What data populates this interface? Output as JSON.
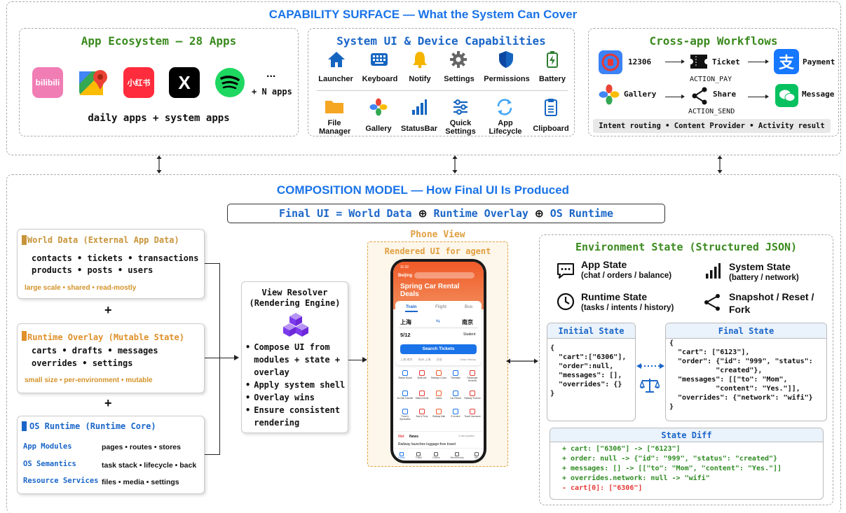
{
  "capability": {
    "title": "CAPABILITY SURFACE — What the System Can Cover",
    "app_ecosystem": {
      "title": "App Ecosystem — 28 Apps",
      "apps": [
        {
          "name": "bilibili",
          "label": "bilibili"
        },
        {
          "name": "maps",
          "label": ""
        },
        {
          "name": "xiaohongshu",
          "label": "小红书"
        },
        {
          "name": "x",
          "label": "X"
        },
        {
          "name": "spotify",
          "label": ""
        }
      ],
      "ellipsis": "...",
      "more": "+ N apps",
      "caption": "daily apps + system apps"
    },
    "system_ui": {
      "title": "System UI & Device Capabilities",
      "row1": [
        "Launcher",
        "Keyboard",
        "Notify",
        "Settings",
        "Permissions",
        "Battery"
      ],
      "row2": [
        "File Manager",
        "Gallery",
        "StatusBar",
        "Quick Settings",
        "App Lifecycle",
        "Clipboard"
      ]
    },
    "cross_app": {
      "title": "Cross-app Workflows",
      "flow1": {
        "from": "12306",
        "mid": "Ticket",
        "action": "ACTION_PAY",
        "to": "Payment"
      },
      "flow2": {
        "from": "Gallery",
        "mid": "Share",
        "action": "ACTION_SEND",
        "to": "Message"
      },
      "footer": "Intent routing • Content Provider • Activity result"
    }
  },
  "composition": {
    "title": "COMPOSITION MODEL — How Final UI Is Produced",
    "formula": {
      "a": "Final UI = World Data",
      "b": "Runtime Overlay",
      "c": "OS Runtime",
      "op": "⊕"
    },
    "world_data": {
      "title": "World Data (External App Data)",
      "line1": "contacts • tickets • transactions",
      "line2": "products • posts  • users",
      "tag": "large scale • shared • read-mostly"
    },
    "plus": "+",
    "runtime_overlay": {
      "title": "Runtime Overlay (Mutable State)",
      "line1": "carts • drafts • messages",
      "line2": "overrides • settings",
      "tag": "small size • per-environment • mutable"
    },
    "os_runtime": {
      "title": "OS Runtime (Runtime Core)",
      "rows": [
        {
          "k": "App Modules",
          "v": "pages • routes • stores"
        },
        {
          "k": "OS Semantics",
          "v": "task stack • lifecycle • back"
        },
        {
          "k": "Resource Services",
          "v": "files • media • settings"
        }
      ]
    },
    "view_resolver": {
      "title1": "View Resolver",
      "title2": "(Rendering Engine)",
      "bullets": [
        "Compose UI from modules + state + overlay",
        "Apply system shell",
        "Overlay wins",
        "Ensure consistent rendering"
      ]
    },
    "phone": {
      "title": "Phone View",
      "subtitle": "Rendered UI for agent",
      "time": "11:02",
      "city": "Beijing",
      "promo": "Spring Car Rental Deals",
      "tabs": [
        "Train",
        "Flight",
        "Bus"
      ],
      "from": "上海",
      "to": "南京",
      "date": "5/12",
      "student": "Student",
      "search": "Search Tickets",
      "history": [
        "上海-南京",
        "杭州-上海",
        "历史",
        "Clear History"
      ],
      "grid": [
        "Station Board",
        "Multi-ride",
        "Railway e-Card",
        "Timetable",
        "Passenger Services",
        "Air-Rail Transfer",
        "Station Mode",
        "Hotels",
        "Car Rental",
        "Railway Tourism",
        "Food & Specialties",
        "Bus & Ferry",
        "Railway Mall",
        "E-Invoice",
        "Travel Insurance"
      ],
      "news_hot": "Hot",
      "news_label": "News",
      "news_more": "3 new updates",
      "news_text": "Railway launches luggage-free travel",
      "nav": [
        "Home",
        "Travel",
        "Orders",
        "Membership",
        "Me"
      ]
    },
    "env_state": {
      "title": "Environment State (Structured JSON)",
      "items": [
        {
          "t": "App State",
          "s": "(chat / orders / balance)"
        },
        {
          "t": "System State",
          "s": "(battery / network)"
        },
        {
          "t": "Runtime State",
          "s": "(tasks / intents / history)"
        },
        {
          "t": "Snapshot / Reset /",
          "s": "Fork"
        }
      ],
      "initial_title": "Initial State",
      "initial_lines": [
        "{",
        "  \"cart\":[\"6306\"],",
        "  \"order\":null,",
        "  \"messages\": [],",
        "  \"overrides\": {}",
        "}"
      ],
      "final_title": "Final State",
      "final_lines": [
        "{",
        "  \"cart\": [\"6123\"],",
        "  \"order\": {\"id\": \"999\", \"status\":",
        "           \"created\"},",
        "  \"messages\": [[\"to\": \"Mom\",",
        "           \"content\": \"Yes.\"]],",
        "  \"overrides\": {\"network\": \"wifi\"}",
        "}"
      ],
      "diff_title": "State Diff",
      "diff_add": [
        "+ cart: [\"6306\"] -> [\"6123\"]",
        "+ order: null -> {\"id\": \"999\", \"status\": \"created\"}",
        "+ messages: [] -> [[\"to\": \"Mom\", \"content\": \"Yes.\"]]",
        "+ overrides.network: null -> \"wifi\""
      ],
      "diff_del": "- cart[0]: [\"6306\"]"
    }
  }
}
